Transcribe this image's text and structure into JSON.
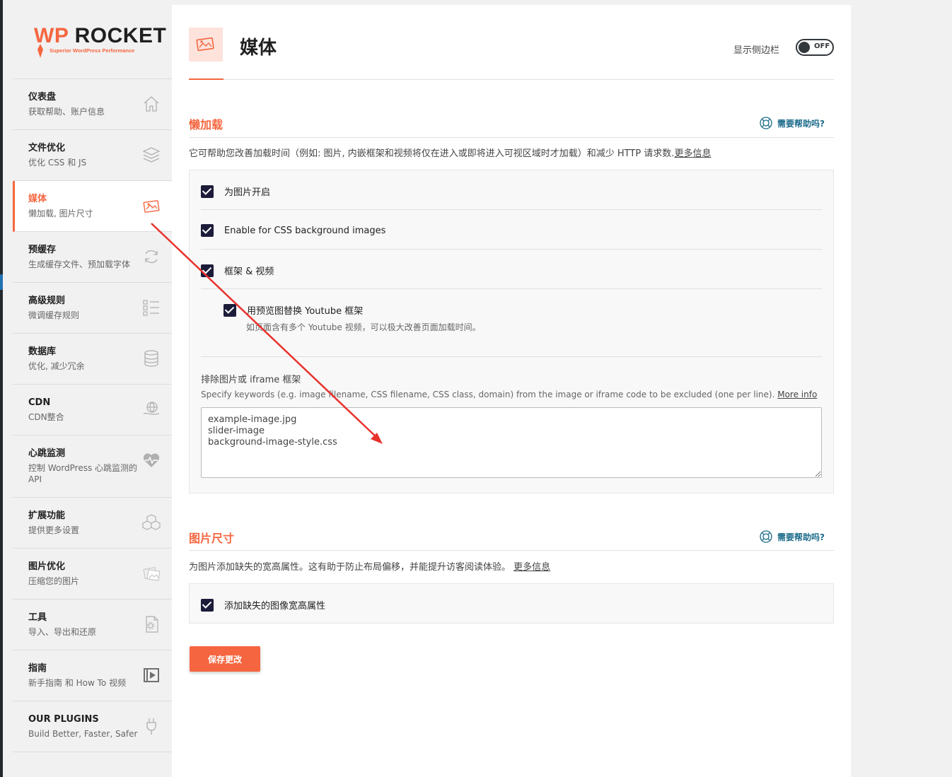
{
  "logo": {
    "brand_wp": "WP",
    "brand_rocket": "ROCKET",
    "tagline": "Superior WordPress Performance"
  },
  "nav": [
    {
      "title": "仪表盘",
      "sub": "获取帮助、账户信息",
      "icon": "home-icon"
    },
    {
      "title": "文件优化",
      "sub": "优化 CSS 和 JS",
      "icon": "layers-icon"
    },
    {
      "title": "媒体",
      "sub": "懒加载, 图片尺寸",
      "icon": "media-icon",
      "active": true
    },
    {
      "title": "预缓存",
      "sub": "生成缓存文件、预加载字体",
      "icon": "refresh-icon"
    },
    {
      "title": "高级规则",
      "sub": "微调缓存规则",
      "icon": "list-icon"
    },
    {
      "title": "数据库",
      "sub": "优化, 减少冗余",
      "icon": "database-icon"
    },
    {
      "title": "CDN",
      "sub": "CDN整合",
      "icon": "globe-hand-icon"
    },
    {
      "title": "心跳监测",
      "sub": "控制 WordPress 心跳监测的 API",
      "icon": "heartbeat-icon"
    },
    {
      "title": "扩展功能",
      "sub": "提供更多设置",
      "icon": "cubes-icon"
    },
    {
      "title": "图片优化",
      "sub": "压缩您的图片",
      "icon": "images-icon"
    },
    {
      "title": "工具",
      "sub": "导入、导出和还原",
      "icon": "file-gear-icon"
    },
    {
      "title": "指南",
      "sub": "新手指南 和 How To 视频",
      "icon": "video-icon"
    },
    {
      "title": "OUR PLUGINS",
      "sub": "Build Better, Faster, Safer",
      "icon": "plug-icon"
    }
  ],
  "header": {
    "title": "媒体",
    "sidebar_toggle_label": "显示侧边栏",
    "toggle_state": "OFF"
  },
  "lazyload": {
    "title": "懒加载",
    "help": "需要帮助吗?",
    "description": "它可帮助您改善加载时间（例如: 图片, 内嵌框架和视频将仅在进入或即将进入可视区域时才加载）和减少 HTTP 请求数.",
    "more_info": "更多信息",
    "options": [
      {
        "label": "为图片开启",
        "checked": true
      },
      {
        "label": "Enable for CSS background images",
        "checked": true
      },
      {
        "label": "框架 & 视频",
        "checked": true
      }
    ],
    "youtube": {
      "label": "用预览图替换 Youtube 框架",
      "hint": "如页面含有多个 Youtube 视频，可以极大改善页面加载时间。",
      "checked": true
    },
    "exclude": {
      "label": "排除图片或 iframe 框架",
      "hint": "Specify keywords (e.g. image filename, CSS filename, CSS class, domain) from the image or iframe code to be excluded (one per line).",
      "more_info": "More info",
      "value": "example-image.jpg\nslider-image\nbackground-image-style.css"
    }
  },
  "image_dims": {
    "title": "图片尺寸",
    "help": "需要帮助吗?",
    "description": "为图片添加缺失的宽高属性。这有助于防止布局偏移，并能提升访客阅读体验。",
    "more_info": "更多信息",
    "option": {
      "label": "添加缺失的图像宽高属性",
      "checked": true
    }
  },
  "save_label": "保存更改",
  "colors": {
    "accent": "#f56640",
    "checkbox": "#1c1c3a",
    "help": "#1b6b8a",
    "annotation": "#e8322b"
  }
}
